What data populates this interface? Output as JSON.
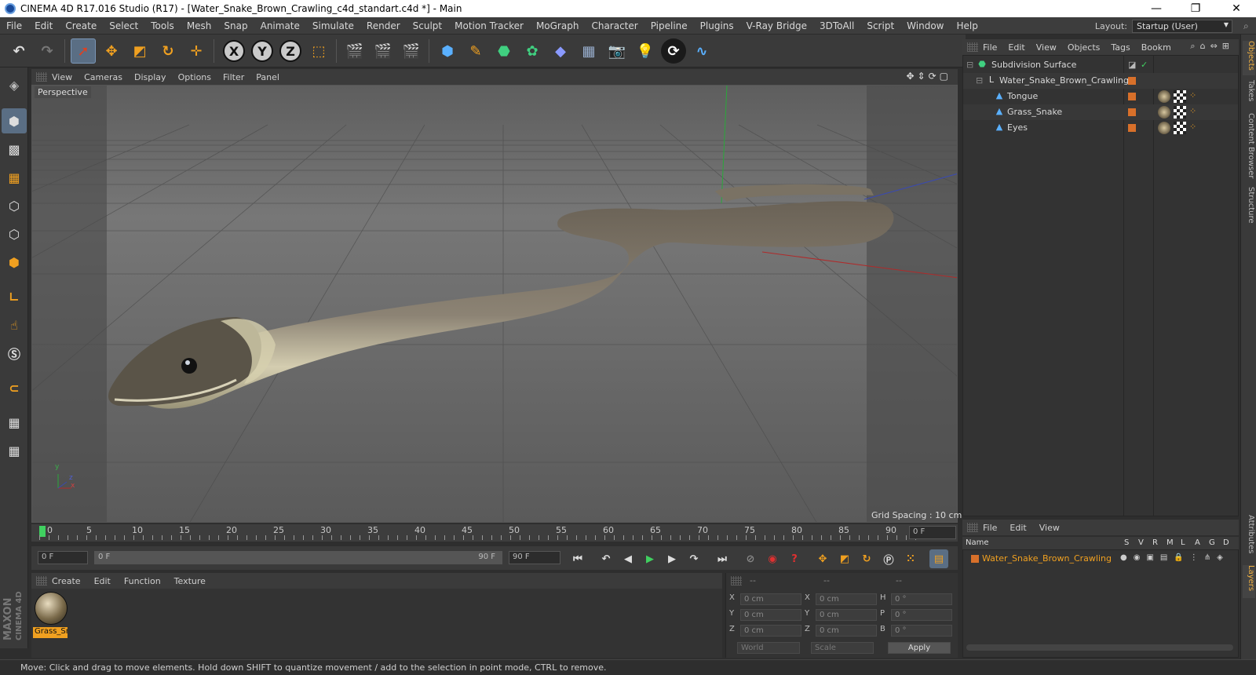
{
  "window": {
    "title": "CINEMA 4D R17.016 Studio (R17) - [Water_Snake_Brown_Crawling_c4d_standart.c4d *] - Main",
    "minimize": "—",
    "maximize": "❐",
    "close": "✕"
  },
  "menubar": {
    "items": [
      "File",
      "Edit",
      "Create",
      "Select",
      "Tools",
      "Mesh",
      "Snap",
      "Animate",
      "Simulate",
      "Render",
      "Sculpt",
      "Motion Tracker",
      "MoGraph",
      "Character",
      "Pipeline",
      "Plugins",
      "V-Ray Bridge",
      "3DToAll",
      "Script",
      "Window",
      "Help"
    ],
    "layout_label": "Layout:",
    "layout_value": "Startup (User)"
  },
  "toolbar": {
    "undo": "↶",
    "redo": "↷",
    "axis_x": "X",
    "axis_y": "Y",
    "axis_z": "Z"
  },
  "viewport": {
    "menu": [
      "View",
      "Cameras",
      "Display",
      "Options",
      "Filter",
      "Panel"
    ],
    "camera_label": "Perspective",
    "grid_spacing": "Grid Spacing : 10 cm",
    "axis_y": "y",
    "axis_z": "z",
    "axis_x": "x"
  },
  "timeline": {
    "ticks": [
      "0",
      "5",
      "10",
      "15",
      "20",
      "25",
      "30",
      "35",
      "40",
      "45",
      "50",
      "55",
      "60",
      "65",
      "70",
      "75",
      "80",
      "85",
      "90"
    ],
    "current_frame_right": "0 F",
    "start_frame": "0 F",
    "range_start": "0 F",
    "range_end": "90 F",
    "end_frame": "90 F"
  },
  "material_manager": {
    "menu": [
      "Create",
      "Edit",
      "Function",
      "Texture"
    ],
    "materials": [
      {
        "name": "Grass_Sn"
      }
    ]
  },
  "coordinates": {
    "header": [
      "--",
      "--",
      "--"
    ],
    "rows": [
      {
        "l1": "X",
        "v1": "0 cm",
        "l2": "X",
        "v2": "0 cm",
        "l3": "H",
        "v3": "0 °"
      },
      {
        "l1": "Y",
        "v1": "0 cm",
        "l2": "Y",
        "v2": "0 cm",
        "l3": "P",
        "v3": "0 °"
      },
      {
        "l1": "Z",
        "v1": "0 cm",
        "l2": "Z",
        "v2": "0 cm",
        "l3": "B",
        "v3": "0 °"
      }
    ],
    "mode1": "World",
    "mode2": "Scale",
    "apply": "Apply"
  },
  "object_manager": {
    "menu": [
      "File",
      "Edit",
      "View",
      "Objects",
      "Tags",
      "Bookm"
    ],
    "objects": [
      {
        "name": "Subdivision Surface"
      },
      {
        "name": "Water_Snake_Brown_Crawling"
      },
      {
        "name": "Tongue"
      },
      {
        "name": "Grass_Snake"
      },
      {
        "name": "Eyes"
      }
    ]
  },
  "layer_manager": {
    "menu": [
      "File",
      "Edit",
      "View"
    ],
    "columns": [
      "Name",
      "S",
      "V",
      "R",
      "M",
      "L",
      "A",
      "G",
      "D"
    ],
    "layers": [
      {
        "name": "Water_Snake_Brown_Crawling",
        "color": "#d8702a"
      }
    ]
  },
  "right_tabs": [
    "Objects",
    "Takes",
    "Content Browser",
    "Structure",
    "Attributes",
    "Layers"
  ],
  "status": "Move: Click and drag to move elements. Hold down SHIFT to quantize movement / add to the selection in point mode, CTRL to remove.",
  "branding": {
    "line1": "MAXON",
    "line2": "CINEMA 4D"
  },
  "colors": {
    "accent": "#f0a020",
    "selection": "#5a6e84",
    "layer": "#d8702a"
  }
}
